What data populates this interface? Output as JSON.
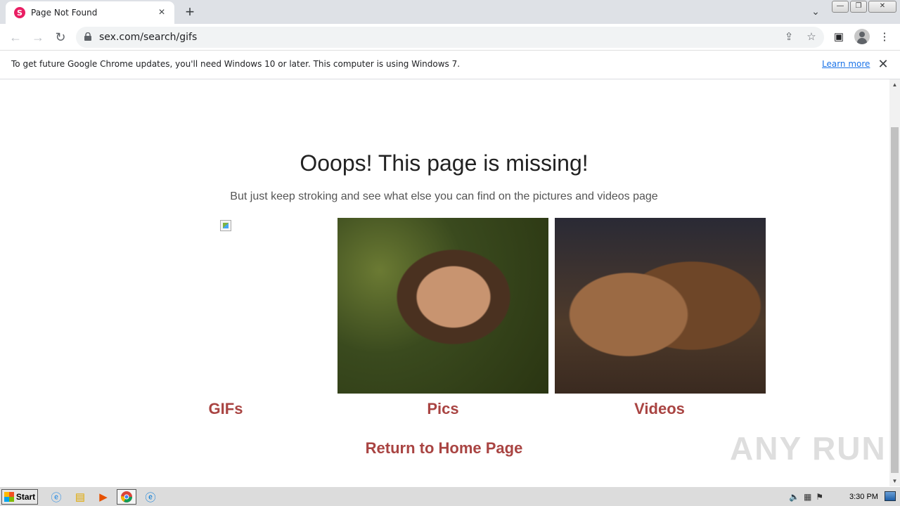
{
  "browser": {
    "tab": {
      "favicon": "S",
      "title": "Page Not Found",
      "close_icon": "×"
    },
    "new_tab_icon": "+",
    "tab_search_icon": "⌄",
    "window_buttons": {
      "minimize": "—",
      "restore": "❐",
      "close": "✕"
    },
    "nav": {
      "back": "←",
      "forward": "→",
      "reload": "↻"
    },
    "url": "sex.com/search/gifs",
    "omnibox_icons": {
      "share": "⇪",
      "bookmark": "☆"
    },
    "toolbar_icons": {
      "side_panel": "▣",
      "menu": "⋮"
    }
  },
  "infobar": {
    "message": "To get future Google Chrome updates, you'll need Windows 10 or later. This computer is using Windows 7.",
    "link": "Learn more",
    "close_icon": "✕"
  },
  "page": {
    "heading": "Ooops! This page is missing!",
    "subheading": "But just keep stroking and see what else you can find on the pictures and videos page",
    "categories": [
      {
        "label": "GIFs"
      },
      {
        "label": "Pics"
      },
      {
        "label": "Videos"
      }
    ],
    "home_link": "Return to Home Page",
    "watermark": "ANY RUN",
    "accent_color": "#a94442"
  },
  "taskbar": {
    "start": "Start",
    "clock": "3:30 PM"
  }
}
